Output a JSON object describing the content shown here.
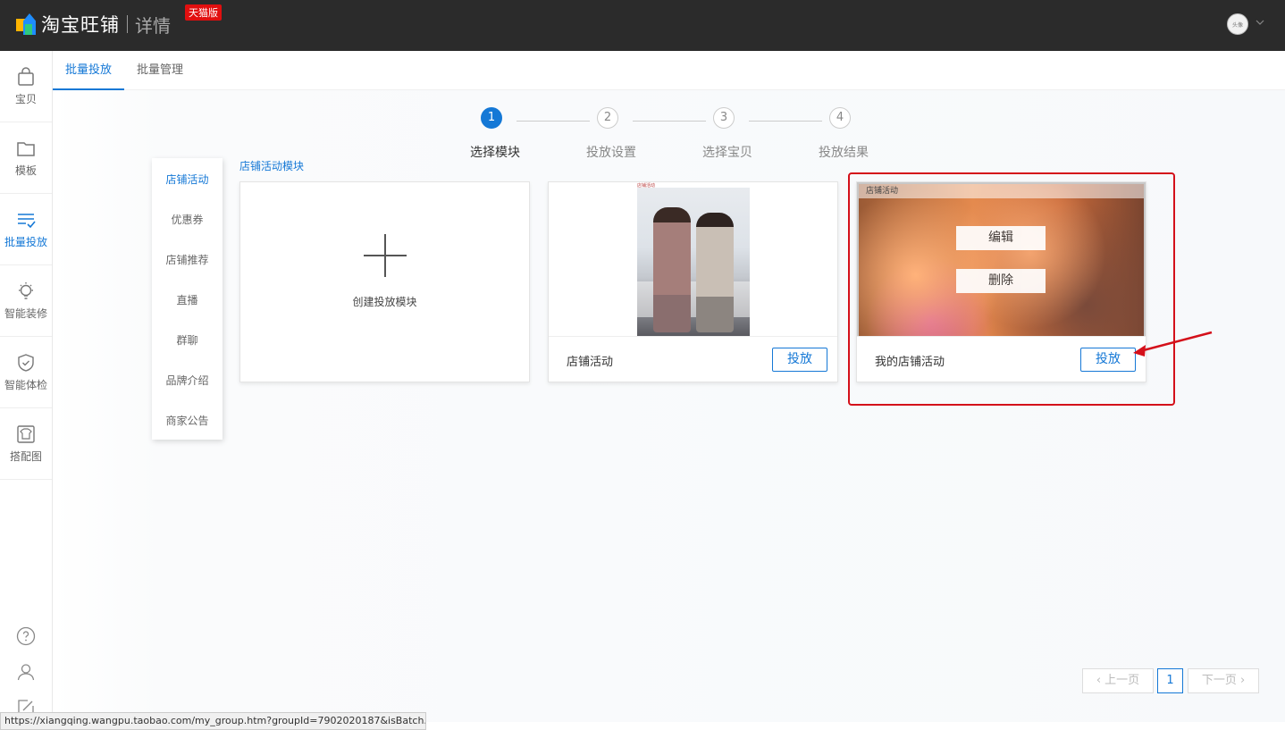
{
  "header": {
    "logo_text": "淘宝旺铺",
    "logo_sub": "详情",
    "badge": "天猫版",
    "avatar_text": "头像"
  },
  "leftnav": {
    "items": [
      {
        "label": "宝贝",
        "icon": "bag-icon"
      },
      {
        "label": "模板",
        "icon": "folder-icon"
      },
      {
        "label": "批量投放",
        "icon": "list-check-icon",
        "active": true
      },
      {
        "label": "智能装修",
        "icon": "lightbulb-icon"
      },
      {
        "label": "智能体检",
        "icon": "shield-check-icon"
      },
      {
        "label": "搭配图",
        "icon": "shirt-icon"
      }
    ]
  },
  "tabs": [
    {
      "label": "批量投放",
      "active": true
    },
    {
      "label": "批量管理",
      "active": false
    }
  ],
  "steps": [
    {
      "num": "1",
      "label": "选择模块",
      "active": true
    },
    {
      "num": "2",
      "label": "投放设置",
      "active": false
    },
    {
      "num": "3",
      "label": "选择宝贝",
      "active": false
    },
    {
      "num": "4",
      "label": "投放结果",
      "active": false
    }
  ],
  "categories": [
    {
      "label": "店铺活动",
      "active": true
    },
    {
      "label": "优惠券"
    },
    {
      "label": "店铺推荐"
    },
    {
      "label": "直播"
    },
    {
      "label": "群聊"
    },
    {
      "label": "品牌介绍"
    },
    {
      "label": "商家公告"
    }
  ],
  "section_title": "店铺活动模块",
  "create_card": {
    "label": "创建投放模块"
  },
  "cards": [
    {
      "title": "店铺活动",
      "button": "投放",
      "thumb_tag": "店铺活动"
    },
    {
      "title": "我的店铺活动",
      "button": "投放",
      "thumb_header": "店铺活动",
      "edit_label": "编辑",
      "delete_label": "删除"
    }
  ],
  "pagination": {
    "prev": "上一页",
    "current": "1",
    "next": "下一页"
  },
  "statusbar": {
    "url": "https://xiangqing.wangpu.taobao.com/my_group.htm?groupId=7902020187&isBatch..."
  },
  "colors": {
    "accent": "#1578d6",
    "highlight": "#d4101a",
    "topbar": "#2b2b2b",
    "badge": "#e10f0f"
  }
}
